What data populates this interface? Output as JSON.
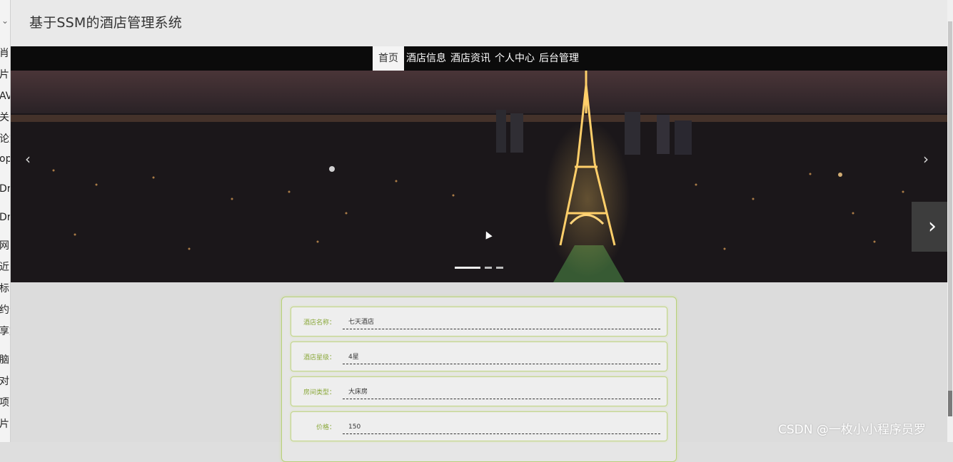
{
  "site": {
    "title": "基于SSM的酒店管理系统"
  },
  "nav": {
    "items": [
      {
        "label": "首页",
        "active": true
      },
      {
        "label": "酒店信息",
        "active": false
      },
      {
        "label": "酒店资讯",
        "active": false
      },
      {
        "label": "个人中心",
        "active": false
      },
      {
        "label": "后台管理",
        "active": false
      }
    ]
  },
  "banner": {
    "prev_icon": "chevron-left-icon",
    "next_icon": "chevron-right-icon",
    "slides": 3,
    "active_slide": 1
  },
  "side_next": {
    "icon": "chevron-right-icon"
  },
  "hotel": {
    "fields": [
      {
        "label": "酒店名称：",
        "value": "七天酒店"
      },
      {
        "label": "酒店星级：",
        "value": "4星"
      },
      {
        "label": "房间类型：",
        "value": "大床房"
      },
      {
        "label": "价格：",
        "value": "150"
      }
    ]
  },
  "left_strip": {
    "fragments": [
      "肖",
      "片",
      "AV",
      "关于",
      "论文",
      "op",
      "Dr",
      "Dr",
      "网",
      "近",
      "标",
      "约云",
      "享文",
      "脑",
      "对",
      "项",
      "片"
    ]
  },
  "watermark": "CSDN @一枚小小程序员罗",
  "colors": {
    "accent_green": "#8aa83a",
    "nav_bg": "#0b0b0b",
    "card_border": "#b8d07a"
  }
}
